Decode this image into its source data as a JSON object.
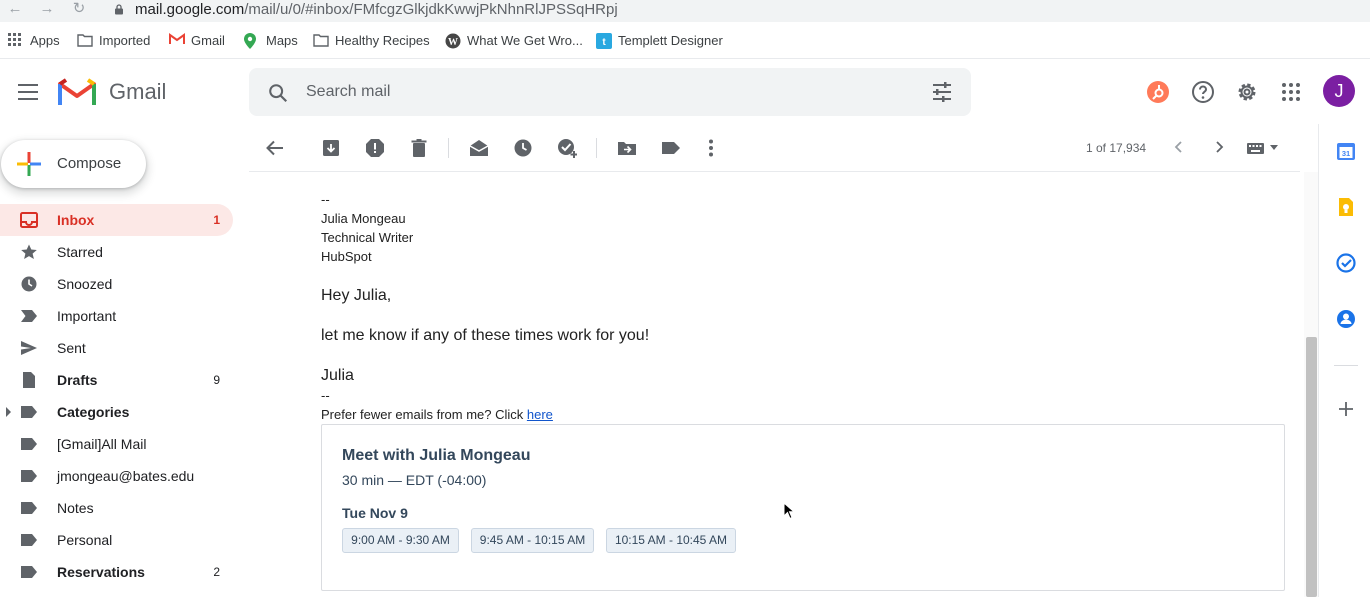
{
  "browser": {
    "url_host": "mail.google.com",
    "url_path": "/mail/u/0/#inbox/FMfcgzGlkjdkKwwjPkNhnRlJPSSqHRpj",
    "bookmarks": [
      {
        "label": "Apps",
        "icon": "apps-grid-icon"
      },
      {
        "label": "Imported",
        "icon": "folder-icon"
      },
      {
        "label": "Gmail",
        "icon": "gmail-icon"
      },
      {
        "label": "Maps",
        "icon": "maps-icon"
      },
      {
        "label": "Healthy Recipes",
        "icon": "folder-icon"
      },
      {
        "label": "What We Get Wro...",
        "icon": "wordpress-icon"
      },
      {
        "label": "Templett Designer",
        "icon": "templett-icon"
      }
    ]
  },
  "header": {
    "app_name": "Gmail",
    "search_placeholder": "Search mail",
    "avatar_initial": "J",
    "avatar_color": "#7b1fa2"
  },
  "compose": {
    "label": "Compose"
  },
  "sidebar": {
    "items": [
      {
        "label": "Inbox",
        "count": "1",
        "icon": "inbox-icon"
      },
      {
        "label": "Starred",
        "count": "",
        "icon": "star-icon"
      },
      {
        "label": "Snoozed",
        "count": "",
        "icon": "clock-icon"
      },
      {
        "label": "Important",
        "count": "",
        "icon": "important-icon"
      },
      {
        "label": "Sent",
        "count": "",
        "icon": "send-icon"
      },
      {
        "label": "Drafts",
        "count": "9",
        "icon": "draft-icon"
      },
      {
        "label": "Categories",
        "count": "",
        "icon": "label-icon"
      },
      {
        "label": "[Gmail]All Mail",
        "count": "",
        "icon": "label-icon"
      },
      {
        "label": "jmongeau@bates.edu",
        "count": "",
        "icon": "label-icon"
      },
      {
        "label": "Notes",
        "count": "",
        "icon": "label-icon"
      },
      {
        "label": "Personal",
        "count": "",
        "icon": "label-icon"
      },
      {
        "label": "Reservations",
        "count": "2",
        "icon": "label-icon"
      }
    ]
  },
  "toolbar": {
    "pager_text": "1 of 17,934"
  },
  "message": {
    "sig_sep": "--",
    "sig_name": "Julia Mongeau",
    "sig_title": "Technical Writer",
    "sig_company": "HubSpot",
    "greeting": "Hey Julia,",
    "body": "let me know if any of these times work for you!",
    "closing": "Julia",
    "sig_sep2": "--",
    "unsub_text": "Prefer fewer emails from me? Click ",
    "unsub_link": "here"
  },
  "meeting": {
    "title": "Meet with Julia Mongeau",
    "subtitle": "30 min — EDT (-04:00)",
    "date": "Tue Nov 9",
    "slots": [
      "9:00 AM - 9:30 AM",
      "9:45 AM - 10:15 AM",
      "10:15 AM - 10:45 AM"
    ]
  }
}
